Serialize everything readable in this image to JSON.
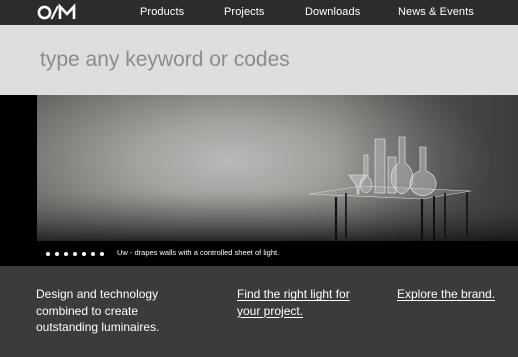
{
  "header": {
    "logo_text": "O/M",
    "nav": [
      {
        "label": "Products"
      },
      {
        "label": "Projects"
      },
      {
        "label": "Downloads"
      },
      {
        "label": "News & Events"
      }
    ]
  },
  "search": {
    "placeholder": "type any keyword or codes"
  },
  "hero": {
    "caption": "Uw - drapes walls with a controlled sheet of light.",
    "slide_count": 7
  },
  "footer_band": {
    "tagline": "Design and technology combined to create outstanding luminaires.",
    "link_find": "Find the right light for your project.",
    "link_brand": "Explore the brand."
  },
  "colors": {
    "topbar": "#2c2c2c",
    "search_band": "#dedede",
    "bottom_band": "#3b3b3b",
    "text_light": "#ffffff"
  }
}
